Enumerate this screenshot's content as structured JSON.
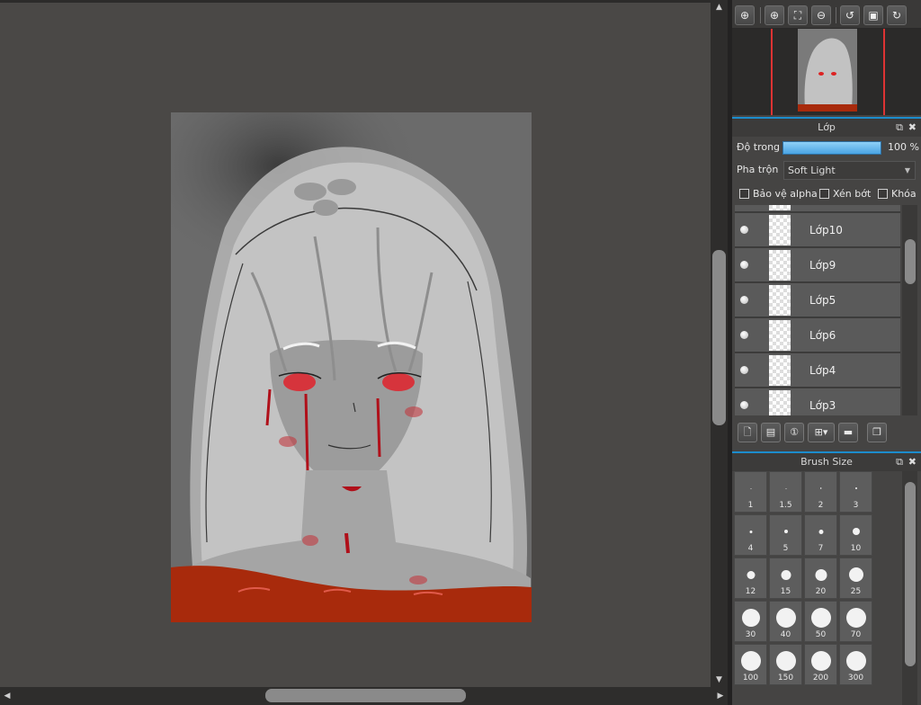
{
  "toolbar": {
    "icons": [
      "zoom-fit-icon",
      "zoom-in-icon",
      "fit-window-icon",
      "zoom-out-icon",
      "rotate-left-icon",
      "reset-view-icon",
      "rotate-right-icon"
    ]
  },
  "layer_panel": {
    "title": "Lớp",
    "opacity_label": "Độ trong",
    "opacity_value": "100 %",
    "opacity_fraction": 1.0,
    "blend_label": "Pha trộn",
    "blend_value": "Soft Light",
    "protect_alpha": "Bảo vệ alpha",
    "clipping": "Xén bớt",
    "lock": "Khóa",
    "layers": [
      {
        "name": "Lớp10"
      },
      {
        "name": "Lớp9"
      },
      {
        "name": "Lớp5"
      },
      {
        "name": "Lớp6"
      },
      {
        "name": "Lớp4"
      },
      {
        "name": "Lớp3"
      }
    ]
  },
  "brush_panel": {
    "title": "Brush Size",
    "sizes": [
      "1",
      "1.5",
      "2",
      "3",
      "4",
      "5",
      "7",
      "10",
      "12",
      "15",
      "20",
      "25",
      "30",
      "40",
      "50",
      "70",
      "100",
      "150",
      "200",
      "300"
    ]
  },
  "colors": {
    "accent": "#1c8ccc",
    "navigator_frame": "#dd3333",
    "artwork_bg": "#6b6b6b",
    "shirt": "#a82a0c",
    "blood": "#c0111a"
  }
}
